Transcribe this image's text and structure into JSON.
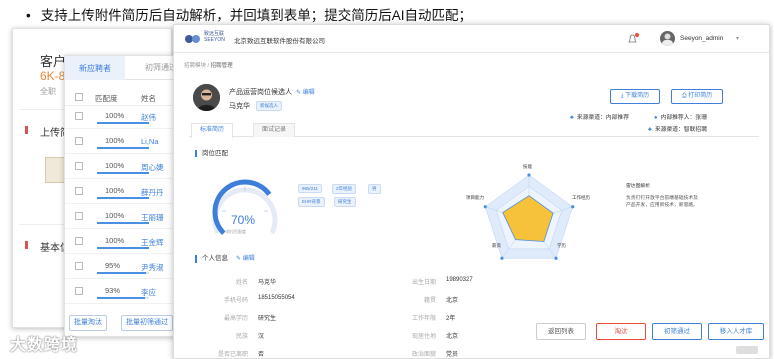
{
  "caption": {
    "bullet": "•",
    "text": "支持上传附件简历后自动解析，并回填到表单；提交简历后AI自动匹配；"
  },
  "back_panel": {
    "title": "客户",
    "salary": "6K-8",
    "sub": "全职",
    "upload_label": "上传简",
    "basic_label": "基本信"
  },
  "list_panel": {
    "tabs": [
      "新应聘者",
      "初筛通过"
    ],
    "headers": {
      "match": "匹配度",
      "name": "姓名"
    },
    "rows": [
      {
        "percent": "100%",
        "fill": 1.0,
        "name": "赵伟"
      },
      {
        "percent": "100%",
        "fill": 1.0,
        "name": "Li,Na"
      },
      {
        "percent": "100%",
        "fill": 1.0,
        "name": "周心婕"
      },
      {
        "percent": "100%",
        "fill": 1.0,
        "name": "薛丹丹"
      },
      {
        "percent": "100%",
        "fill": 1.0,
        "name": "王丽珊"
      },
      {
        "percent": "100%",
        "fill": 1.0,
        "name": "王金辉"
      },
      {
        "percent": "95%",
        "fill": 0.95,
        "name": "尹秀淑"
      },
      {
        "percent": "93%",
        "fill": 0.93,
        "name": "李应"
      },
      {
        "percent": "88%",
        "fill": 0.88,
        "name": "李珊"
      }
    ],
    "buttons": [
      "批量淘汰",
      "批量初筛通过"
    ]
  },
  "main": {
    "topbar": {
      "logo_text": "致远互联 SEEYON",
      "company": "北京致远互联软件股份有限公司",
      "username": "Seeyon_admin",
      "caret": "▾"
    },
    "breadcrumb": {
      "first": "招聘模块",
      "sep": " / ",
      "second": "招聘管理"
    },
    "candidate": {
      "post": "产品运营岗位候选人",
      "edit": "编辑",
      "name": "马克华",
      "tag": "新候选人"
    },
    "actions": {
      "download": "下载简历",
      "print": "打印简历"
    },
    "sources": [
      {
        "text": "来源渠道：内部推荐"
      },
      {
        "text": "内部推荐人：张珊"
      },
      {
        "text": "来源渠道：智联招聘"
      }
    ],
    "subtabs": [
      "标准简历",
      "面试记录"
    ],
    "match_section": "岗位匹配",
    "gauge": {
      "value": "70%",
      "fraction": 0.7,
      "caption": "岗位匹配度"
    },
    "tags": [
      "985/211",
      "2年经验",
      "男",
      "EHR背景",
      "研究生"
    ],
    "radar": {
      "labels": [
        "技能",
        "工作经历",
        "学历",
        "薪资",
        "项目能力"
      ],
      "values": [
        0.55,
        0.55,
        0.55,
        0.5,
        0.6
      ],
      "fill_color": "#f5c23a",
      "outline_color": "#4a90e2"
    },
    "analysis": {
      "title": "雷达图解析",
      "body": "负责钉钉开放平台前端基础技术及产品开发，应用新技术，新思路。"
    },
    "info_section": "个人信息",
    "info_edit": "编辑",
    "info": [
      {
        "label": "姓名",
        "value": "马克华",
        "label2": "出生日期",
        "value2": "19890327"
      },
      {
        "label": "手机号码",
        "value": "18515055054",
        "label2": "籍贯",
        "value2": "北京"
      },
      {
        "label": "最高学历",
        "value": "研究生",
        "label2": "工作年限",
        "value2": "2年"
      },
      {
        "label": "民族",
        "value": "汉",
        "label2": "现居住地",
        "value2": "北京"
      },
      {
        "label": "是否已离职",
        "value": "否",
        "label2": "政治面貌",
        "value2": "党员"
      }
    ],
    "footer": {
      "back": "返回列表",
      "eliminate": "淘汰",
      "pass": "初筛通过",
      "talent": "移入人才库"
    }
  },
  "watermark": "大数跨境",
  "colors": {
    "accent": "#3d7fdb",
    "danger": "#e74c3c",
    "orange": "#e8883a"
  }
}
